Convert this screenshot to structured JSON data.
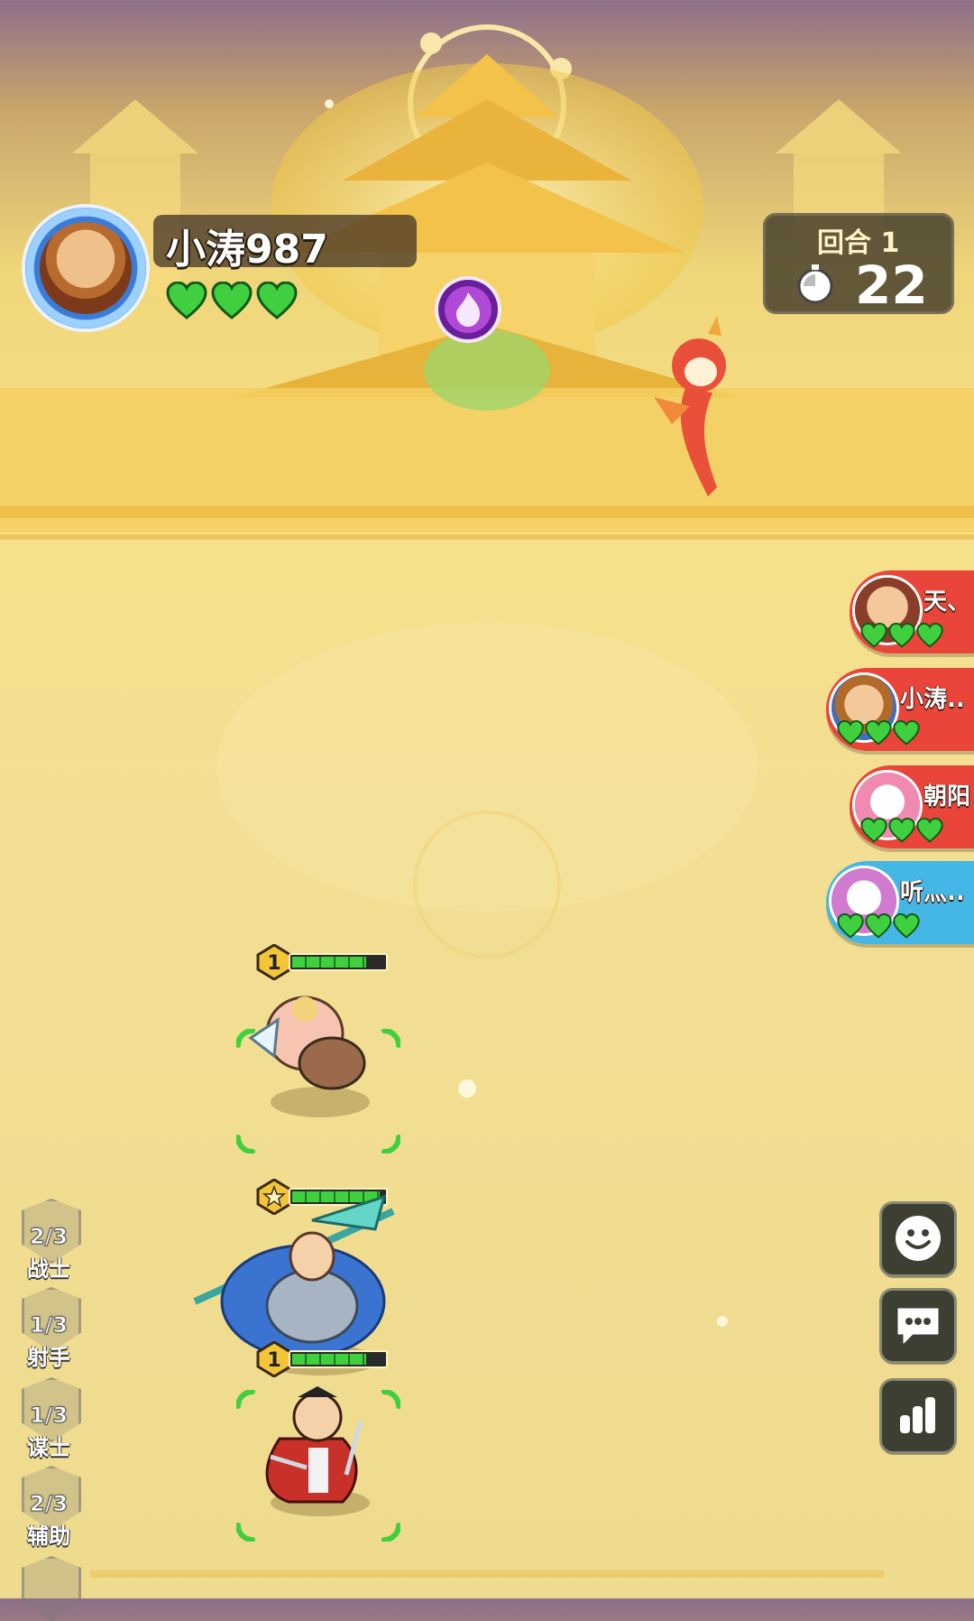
{
  "player": {
    "name": "小涛987",
    "lives": 3
  },
  "round": {
    "label": "回合 1",
    "timer": "22"
  },
  "opponents": [
    {
      "name": "天、",
      "lives": 3,
      "color": "#e9453b"
    },
    {
      "name": "小涛..",
      "lives": 3,
      "color": "#e9453b"
    },
    {
      "name": "朝阳",
      "lives": 3,
      "color": "#e9453b"
    },
    {
      "name": "听灬..",
      "lives": 3,
      "color": "#45b7e6"
    }
  ],
  "units": [
    {
      "name": "pig-warrior",
      "level": "1",
      "hp": 0.8
    },
    {
      "name": "blue-general",
      "level": "star",
      "hp": 0.95
    },
    {
      "name": "red-swordsman",
      "level": "1",
      "hp": 0.8
    }
  ],
  "classes": [
    {
      "count": "2/3",
      "label": "战士"
    },
    {
      "count": "1/3",
      "label": "射手"
    },
    {
      "count": "1/3",
      "label": "谋士"
    },
    {
      "count": "2/3",
      "label": "辅助"
    }
  ],
  "buttons": {
    "emote": "smile-icon",
    "chat": "chat-bubble-icon",
    "stats": "bar-chart-icon"
  },
  "colors": {
    "heart": "#3fcf3f",
    "gold": "#f6e08a"
  }
}
